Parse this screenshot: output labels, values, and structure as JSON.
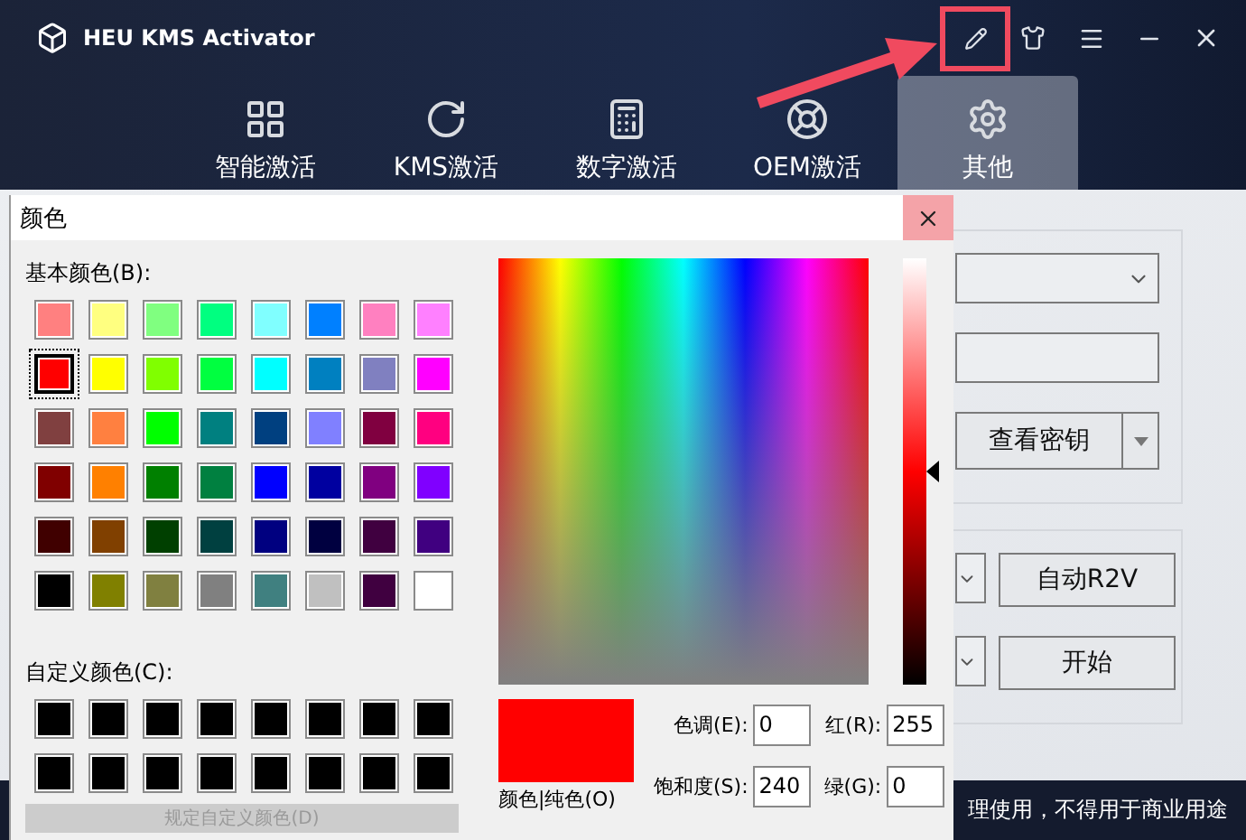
{
  "app": {
    "title": "HEU KMS Activator",
    "nav_tabs": [
      {
        "label": "智能激活",
        "selected": false,
        "kind": "windows"
      },
      {
        "label": "KMS激活",
        "selected": false,
        "kind": "kms"
      },
      {
        "label": "数字激活",
        "selected": false,
        "kind": "digital"
      },
      {
        "label": "OEM激活",
        "selected": false,
        "kind": "oem"
      },
      {
        "label": "其他",
        "selected": true,
        "kind": "other"
      }
    ],
    "key_button": "查看密钥",
    "buttons": [
      "自动R2V",
      "开始"
    ],
    "status_text": "理使用，不得用于商业用途"
  },
  "color_dialog": {
    "title": "颜色",
    "basic_label": "基本颜色(B):",
    "basic_colors": [
      {
        "color": "#ff8080",
        "selected": false
      },
      {
        "color": "#ffff80",
        "selected": false
      },
      {
        "color": "#80ff80",
        "selected": false
      },
      {
        "color": "#00ff80",
        "selected": false
      },
      {
        "color": "#80ffff",
        "selected": false
      },
      {
        "color": "#0080ff",
        "selected": false
      },
      {
        "color": "#ff80c0",
        "selected": false
      },
      {
        "color": "#ff80ff",
        "selected": false
      },
      {
        "color": "#ff0000",
        "selected": true
      },
      {
        "color": "#ffff00",
        "selected": false
      },
      {
        "color": "#80ff00",
        "selected": false
      },
      {
        "color": "#00ff40",
        "selected": false
      },
      {
        "color": "#00ffff",
        "selected": false
      },
      {
        "color": "#0080c0",
        "selected": false
      },
      {
        "color": "#8080c0",
        "selected": false
      },
      {
        "color": "#ff00ff",
        "selected": false
      },
      {
        "color": "#804040",
        "selected": false
      },
      {
        "color": "#ff8040",
        "selected": false
      },
      {
        "color": "#00ff00",
        "selected": false
      },
      {
        "color": "#008080",
        "selected": false
      },
      {
        "color": "#004080",
        "selected": false
      },
      {
        "color": "#8080ff",
        "selected": false
      },
      {
        "color": "#800040",
        "selected": false
      },
      {
        "color": "#ff0080",
        "selected": false
      },
      {
        "color": "#800000",
        "selected": false
      },
      {
        "color": "#ff8000",
        "selected": false
      },
      {
        "color": "#008000",
        "selected": false
      },
      {
        "color": "#008040",
        "selected": false
      },
      {
        "color": "#0000ff",
        "selected": false
      },
      {
        "color": "#0000a0",
        "selected": false
      },
      {
        "color": "#800080",
        "selected": false
      },
      {
        "color": "#8000ff",
        "selected": false
      },
      {
        "color": "#400000",
        "selected": false
      },
      {
        "color": "#804000",
        "selected": false
      },
      {
        "color": "#004000",
        "selected": false
      },
      {
        "color": "#004040",
        "selected": false
      },
      {
        "color": "#000080",
        "selected": false
      },
      {
        "color": "#000040",
        "selected": false
      },
      {
        "color": "#400040",
        "selected": false
      },
      {
        "color": "#400080",
        "selected": false
      },
      {
        "color": "#000000",
        "selected": false
      },
      {
        "color": "#808000",
        "selected": false
      },
      {
        "color": "#808040",
        "selected": false
      },
      {
        "color": "#808080",
        "selected": false
      },
      {
        "color": "#408080",
        "selected": false
      },
      {
        "color": "#c0c0c0",
        "selected": false
      },
      {
        "color": "#400040",
        "selected": false
      },
      {
        "color": "#ffffff",
        "selected": false
      }
    ],
    "custom_label": "自定义颜色(C):",
    "custom_colors": [
      {
        "color": "#000000"
      },
      {
        "color": "#000000"
      },
      {
        "color": "#000000"
      },
      {
        "color": "#000000"
      },
      {
        "color": "#000000"
      },
      {
        "color": "#000000"
      },
      {
        "color": "#000000"
      },
      {
        "color": "#000000"
      },
      {
        "color": "#000000"
      },
      {
        "color": "#000000"
      },
      {
        "color": "#000000"
      },
      {
        "color": "#000000"
      },
      {
        "color": "#000000"
      },
      {
        "color": "#000000"
      },
      {
        "color": "#000000"
      },
      {
        "color": "#000000"
      }
    ],
    "define_custom_button": {
      "label": "规定自定义颜色(D)",
      "disabled": true
    },
    "luminance": {
      "level": 0.5
    },
    "preview_label": "颜色|纯色(O)",
    "fields": [
      {
        "label": "色调(E):",
        "value": "0"
      },
      {
        "label": "红(R):",
        "value": "255"
      },
      {
        "label": "饱和度(S):",
        "value": "240"
      },
      {
        "label": "绿(G):",
        "value": "0"
      }
    ]
  }
}
